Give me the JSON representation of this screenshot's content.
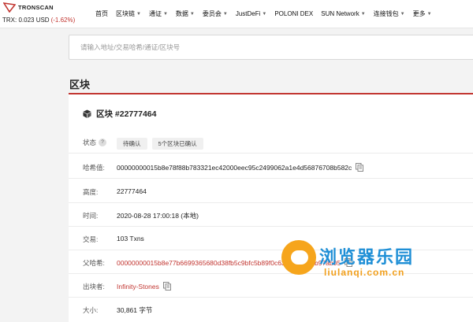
{
  "brand": {
    "name": "TRONSCAN"
  },
  "ticker": {
    "text": "TRX: 0.023 USD",
    "change": "(-1.62%)"
  },
  "nav": [
    {
      "label": "首页",
      "dropdown": false
    },
    {
      "label": "区块链",
      "dropdown": true
    },
    {
      "label": "通证",
      "dropdown": true
    },
    {
      "label": "数据",
      "dropdown": true
    },
    {
      "label": "委员会",
      "dropdown": true
    },
    {
      "label": "JustDeFi",
      "dropdown": true
    },
    {
      "label": "POLONI DEX",
      "dropdown": false
    },
    {
      "label": "SUN Network",
      "dropdown": true
    },
    {
      "label": "连接钱包",
      "dropdown": true
    },
    {
      "label": "更多",
      "dropdown": true
    }
  ],
  "search": {
    "placeholder": "请输入地址/交易哈希/通证/区块号"
  },
  "section": {
    "title": "区块"
  },
  "block": {
    "title": "区块 #22777464",
    "status_label": "状态",
    "status_help": "?",
    "status_value": "待确认",
    "status_confirms": "5个区块已确认",
    "hash_label": "哈希值:",
    "hash_value": "00000000015b8e78f88b783321ec42000eec95c2499062a1e4d56876708b582c",
    "height_label": "高度:",
    "height_value": "22777464",
    "time_label": "时间:",
    "time_value": "2020-08-28 17:00:18 (本地)",
    "tx_label": "交易:",
    "tx_value": "103 Txns",
    "parent_label": "父哈希:",
    "parent_value": "00000000015b8e77b6699365680d38fb5c9bfc5b89f0c63489ce6b8b97ab05",
    "producer_label": "出块者:",
    "producer_value": "Infinity-Stones",
    "size_label": "大小:",
    "size_value": "30,861 字节"
  },
  "watermark": {
    "cn": "浏览器乐园",
    "en": "liulanqi.com.cn"
  },
  "colors": {
    "accent": "#c23631",
    "watermark_blue": "#1f8fd6",
    "watermark_orange": "#f2a01d"
  },
  "icons": {
    "logo": "tronscan-logo-icon",
    "block": "cube-icon",
    "copy": "copy-icon",
    "help": "question-icon",
    "caret": "chevron-down-icon"
  }
}
